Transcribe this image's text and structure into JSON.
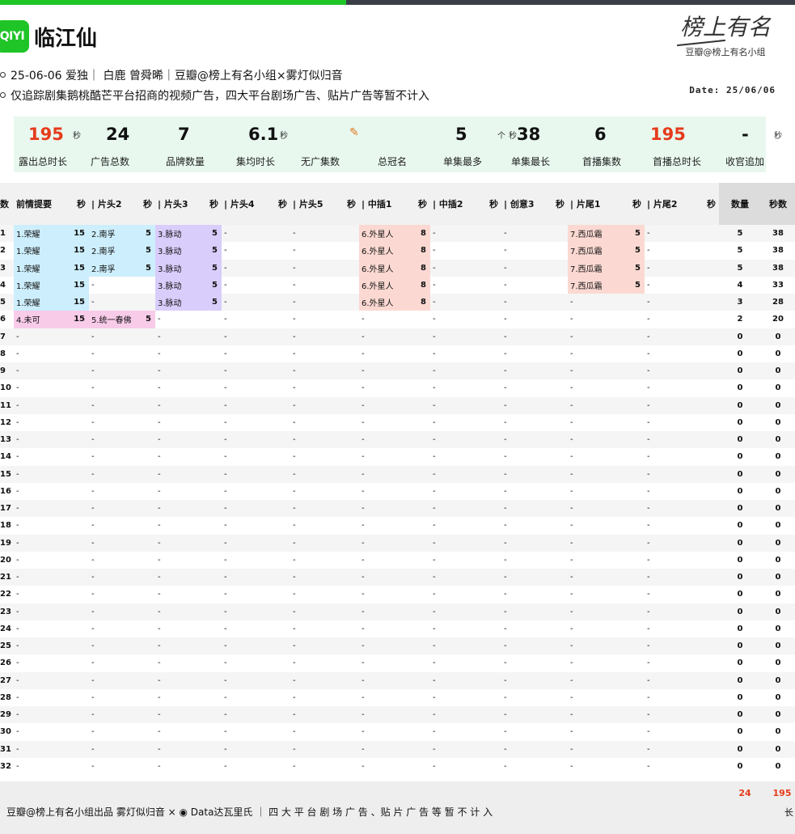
{
  "header": {
    "logo_text": "QIYI",
    "title": "临江仙",
    "info_line1": "25-06-06 爱独｜ 白鹿 曾舜晞｜豆瓣@榜上有名小组×雾灯似归音",
    "info_line2": "仅追踪剧集鹅桃酷芒平台招商的视频广告，四大平台剧场广告、贴片广告等暂不计入",
    "date": "Date: 25/06/06",
    "brand_signature": "榜上有名",
    "brand_sub": "豆瓣@榜上有名小组"
  },
  "summary": [
    {
      "value": "195",
      "unit": "秒",
      "label": "露出总时长",
      "red": true
    },
    {
      "value": "24",
      "unit": "",
      "label": "广告总数",
      "red": false
    },
    {
      "value": "7",
      "unit": "",
      "label": "品牌数量",
      "red": false
    },
    {
      "value": "6.1",
      "unit": "秒",
      "label": "集均时长",
      "red": false
    },
    {
      "value": "",
      "unit": "",
      "label": "无广集数",
      "red": false
    },
    {
      "value": "",
      "unit": "",
      "label": "总冠名",
      "red": false
    },
    {
      "value": "5",
      "unit": "个",
      "label": "单集最多",
      "red": false
    },
    {
      "value": "38",
      "unit": "秒",
      "label": "单集最长",
      "red": false
    },
    {
      "value": "6",
      "unit": "",
      "label": "首播集数",
      "red": false
    },
    {
      "value": "195",
      "unit": "",
      "label": "首播总时长",
      "red": true
    },
    {
      "value": "-",
      "unit": "秒",
      "label": "收官追加",
      "red": false
    }
  ],
  "table": {
    "headers": [
      "数",
      "前情提要",
      "秒",
      "| 片头2",
      "秒",
      "| 片头3",
      "秒",
      "| 片头4",
      "秒",
      "| 片头5",
      "秒",
      "| 中插1",
      "秒",
      "| 中插2",
      "秒",
      "| 创意3",
      "秒",
      "| 片尾1",
      "秒",
      "| 片尾2",
      "秒",
      "数量",
      "秒数"
    ],
    "rows": [
      {
        "ep": "1",
        "cells": [
          [
            "1.荣耀",
            "15",
            "blue"
          ],
          [
            "2.南孚",
            "5",
            "blue"
          ],
          [
            "3.脉动",
            "5",
            "purple"
          ],
          [
            "-",
            "",
            ""
          ],
          [
            "-",
            "",
            ""
          ],
          [
            "6.外星人",
            "8",
            "red"
          ],
          [
            "-",
            "",
            ""
          ],
          [
            "-",
            "",
            ""
          ],
          [
            "7.西瓜霜",
            "5",
            "red"
          ],
          [
            "-",
            "",
            ""
          ]
        ],
        "count": "5",
        "secs": "38"
      },
      {
        "ep": "2",
        "cells": [
          [
            "1.荣耀",
            "15",
            "blue"
          ],
          [
            "2.南孚",
            "5",
            "blue"
          ],
          [
            "3.脉动",
            "5",
            "purple"
          ],
          [
            "-",
            "",
            ""
          ],
          [
            "-",
            "",
            ""
          ],
          [
            "6.外星人",
            "8",
            "red"
          ],
          [
            "-",
            "",
            ""
          ],
          [
            "-",
            "",
            ""
          ],
          [
            "7.西瓜霜",
            "5",
            "red"
          ],
          [
            "-",
            "",
            ""
          ]
        ],
        "count": "5",
        "secs": "38"
      },
      {
        "ep": "3",
        "cells": [
          [
            "1.荣耀",
            "15",
            "blue"
          ],
          [
            "2.南孚",
            "5",
            "blue"
          ],
          [
            "3.脉动",
            "5",
            "purple"
          ],
          [
            "-",
            "",
            ""
          ],
          [
            "-",
            "",
            ""
          ],
          [
            "6.外星人",
            "8",
            "red"
          ],
          [
            "-",
            "",
            ""
          ],
          [
            "-",
            "",
            ""
          ],
          [
            "7.西瓜霜",
            "5",
            "red"
          ],
          [
            "-",
            "",
            ""
          ]
        ],
        "count": "5",
        "secs": "38"
      },
      {
        "ep": "4",
        "cells": [
          [
            "1.荣耀",
            "15",
            "blue"
          ],
          [
            "-",
            "",
            ""
          ],
          [
            "3.脉动",
            "5",
            "purple"
          ],
          [
            "-",
            "",
            ""
          ],
          [
            "-",
            "",
            ""
          ],
          [
            "6.外星人",
            "8",
            "red"
          ],
          [
            "-",
            "",
            ""
          ],
          [
            "-",
            "",
            ""
          ],
          [
            "7.西瓜霜",
            "5",
            "red"
          ],
          [
            "-",
            "",
            ""
          ]
        ],
        "count": "4",
        "secs": "33"
      },
      {
        "ep": "5",
        "cells": [
          [
            "1.荣耀",
            "15",
            "blue"
          ],
          [
            "-",
            "",
            ""
          ],
          [
            "3.脉动",
            "5",
            "purple"
          ],
          [
            "-",
            "",
            ""
          ],
          [
            "-",
            "",
            ""
          ],
          [
            "6.外星人",
            "8",
            "red"
          ],
          [
            "-",
            "",
            ""
          ],
          [
            "-",
            "",
            ""
          ],
          [
            "-",
            "",
            ""
          ],
          [
            "-",
            "",
            ""
          ]
        ],
        "count": "3",
        "secs": "28"
      },
      {
        "ep": "6",
        "cells": [
          [
            "4.未可",
            "15",
            "pink"
          ],
          [
            "5.统一春佛",
            "5",
            "pink"
          ],
          [
            "-",
            "",
            ""
          ],
          [
            "-",
            "",
            ""
          ],
          [
            "-",
            "",
            ""
          ],
          [
            "-",
            "",
            ""
          ],
          [
            "-",
            "",
            ""
          ],
          [
            "-",
            "",
            ""
          ],
          [
            "-",
            "",
            ""
          ],
          [
            "-",
            "",
            ""
          ]
        ],
        "count": "2",
        "secs": "20"
      }
    ],
    "empty_from": 7,
    "empty_to": 32,
    "empty_cell": "-",
    "empty_count": "0",
    "empty_secs": "0"
  },
  "footer": {
    "text": "豆瓣@榜上有名小组出品  雾灯似归音 × ◉ Data达瓦里氏 ｜ 四 大 平 台 剧 场 广 告 、贴 片 广 告 等 暂 不 计 入",
    "total_count": "24",
    "total_secs": "195",
    "cut_glyph": "长"
  },
  "colors": {
    "accent_green": "#1fc427",
    "highlight_red": "#e53b1b",
    "cell_blue": "#cdeefc",
    "cell_purple": "#d9cdfb",
    "cell_red": "#fbd9d2",
    "cell_pink": "#f8cbe9"
  }
}
